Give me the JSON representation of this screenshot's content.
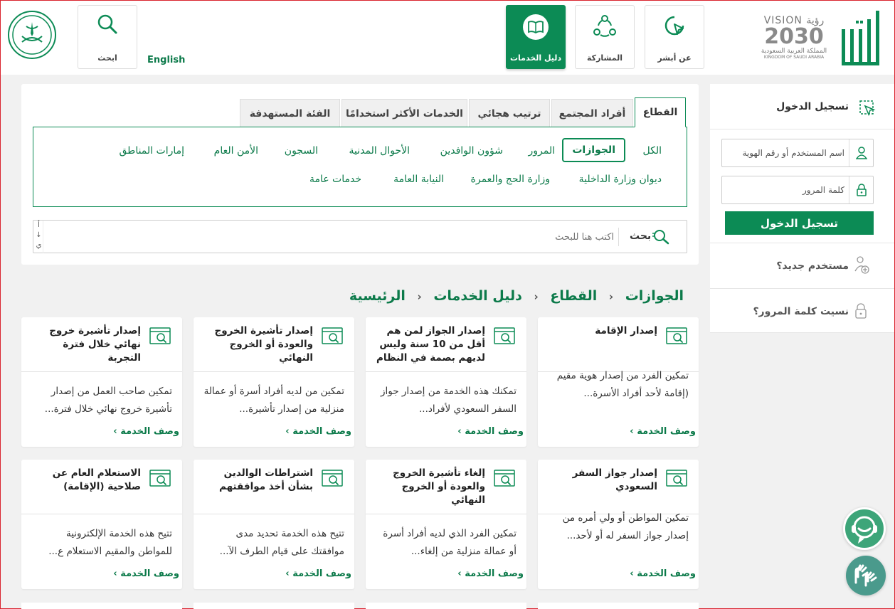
{
  "header": {
    "english_label": "English",
    "nav": {
      "search": "ابحث",
      "services_guide": "دليل الخدمات",
      "participation": "المشاركة",
      "about": "عن أبشر"
    },
    "vision": {
      "line1": "VISION رؤية",
      "line2": "2030",
      "line3": "المملكة العربية السعودية",
      "line4": "KINGDOM OF SAUDI ARABIA"
    }
  },
  "tabs": [
    "القطاع",
    "أفراد المجتمع",
    "ترتيب هجائي",
    "الخدمات الأكثر استخدامًا",
    "الفئة المستهدفة"
  ],
  "categories_row1": [
    "الكل",
    "الجوازات",
    "المرور",
    "شؤون الوافدين",
    "الأحوال المدنية",
    "السجون",
    "الأمن العام",
    "إمارات المناطق"
  ],
  "categories_row2": [
    "ديوان وزارة الداخلية",
    "وزارة الحج والعمرة",
    "النيابة العامة",
    "خدمات عامة"
  ],
  "search": {
    "label": "بحث",
    "placeholder": "اكتب هنا للبحث",
    "sort_top": "أ",
    "sort_arrow": "↓",
    "sort_bottom": "ي"
  },
  "breadcrumb": [
    "الرئيسية",
    "دليل الخدمات",
    "القطاع",
    "الجوازات"
  ],
  "services": [
    {
      "title": "إصدار الإقامة",
      "desc": "تمكين الفرد من إصدار هوية مقيم (إقامة لأحد أفراد الأسرة...",
      "link": "وصف الخدمة"
    },
    {
      "title": "إصدار الجواز لمن هم أقل من 10 سنة وليس لديهم بصمة في النظام",
      "desc": "تمكنك هذه الخدمة من إصدار جواز السفر السعودي لأفراد...",
      "link": "وصف الخدمة"
    },
    {
      "title": "إصدار تأشيرة الخروج والعودة أو الخروج النهائي",
      "desc": "تمكين من لديه أفراد أسرة أو عمالة منزلية من إصدار تأشيرة...",
      "link": "وصف الخدمة"
    },
    {
      "title": "إصدار تأشيرة خروج نهائي خلال فترة التجربة",
      "desc": "تمكين صاحب العمل من إصدار تأشيرة خروج نهائي خلال فترة...",
      "link": "وصف الخدمة"
    },
    {
      "title": "إصدار جواز السفر السعودي",
      "desc": "تمكين المواطن أو ولي أمره من إصدار جواز السفر له أو لأحد...",
      "link": "وصف الخدمة"
    },
    {
      "title": "إلغاء تأشيرة الخروج والعودة أو الخروج النهائي",
      "desc": "تمكين الفرد الذي لديه أفراد أسرة أو عمالة منزلية من إلغاء...",
      "link": "وصف الخدمة"
    },
    {
      "title": "اشتراطات الوالدين بشأن أخذ موافقتهم",
      "desc": "تتيح هذه الخدمة تحديد مدى موافقتك على قيام الطرف الآ...",
      "link": "وصف الخدمة"
    },
    {
      "title": "الاستعلام العام عن صلاحية (الإقامة)",
      "desc": "تتيح هذه الخدمة الإلكترونية للمواطن والمقيم الاستعلام ع...",
      "link": "وصف الخدمة"
    }
  ],
  "login": {
    "title": "تسجيل الدخول",
    "username_placeholder": "اسم المستخدم أو رقم الهوية",
    "password_placeholder": "كلمة المرور",
    "button": "تسجيل الدخول",
    "new_user": "مستخدم جديد؟",
    "forgot_password": "نسيت كلمة المرور؟"
  },
  "colors": {
    "primary": "#0c8b55",
    "link": "#0c7a4a",
    "background": "#f1f1f1"
  }
}
